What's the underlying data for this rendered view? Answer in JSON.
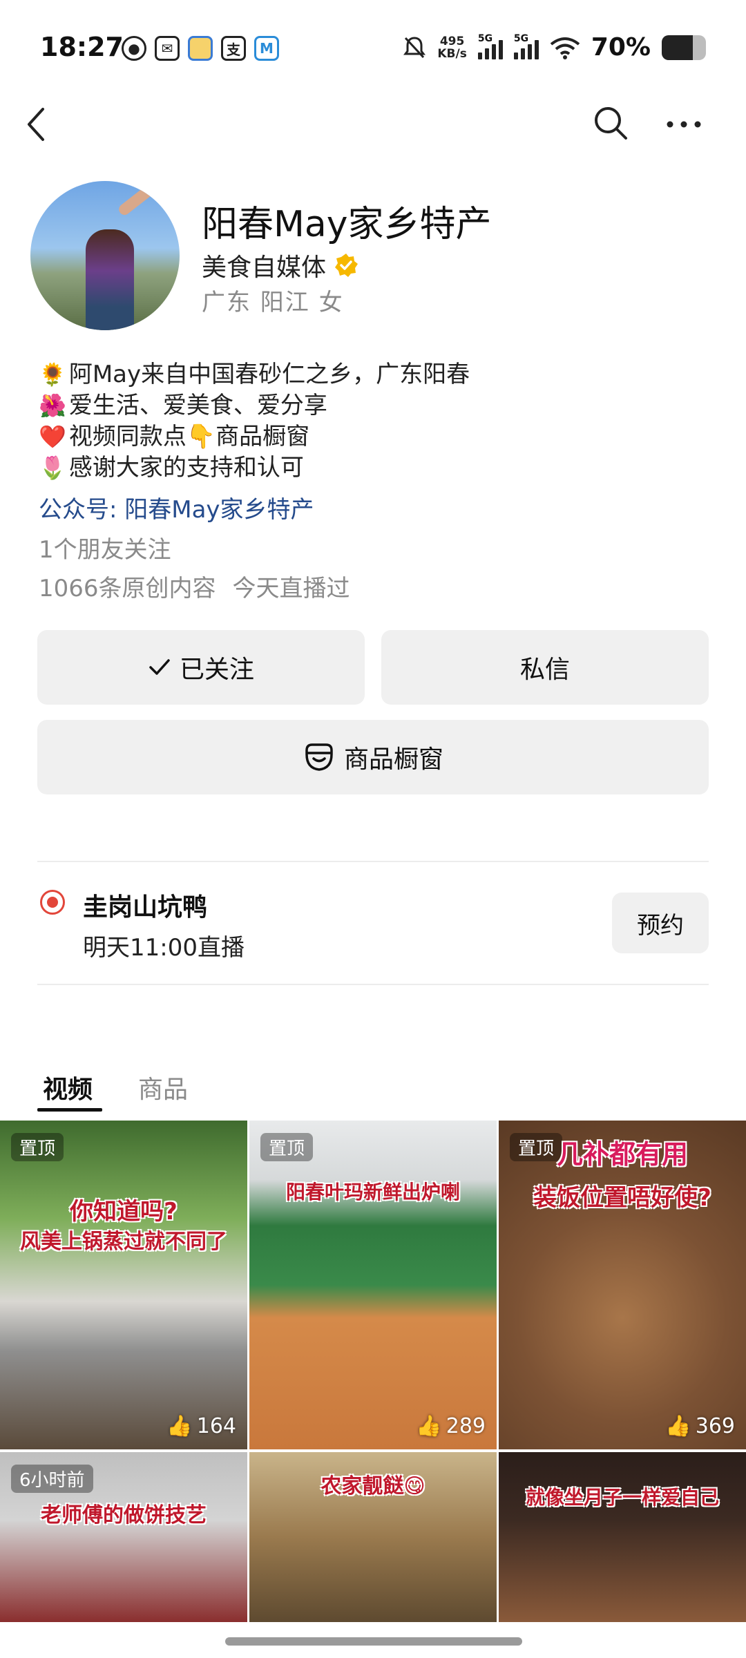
{
  "status_bar": {
    "time": "18:27",
    "net_speed_value": "495",
    "net_speed_unit": "KB/s",
    "sig1": "5G",
    "sig2": "5G",
    "battery": "70%",
    "battery_level": 0.7
  },
  "profile": {
    "name": "阳春May家乡特产",
    "category": "美食自媒体",
    "location": "广东 阳江 女",
    "bio": [
      {
        "emoji": "🌻",
        "text": "阿May来自中国春砂仁之乡，广东阳春"
      },
      {
        "emoji": "🌺",
        "text": "爱生活、爱美食、爱分享"
      },
      {
        "emoji": "❤️",
        "text": "视频同款点👇商品橱窗"
      },
      {
        "emoji": "🌷",
        "text": "感谢大家的支持和认可"
      }
    ],
    "official_account": "公众号: 阳春May家乡特产",
    "friends": "1个朋友关注",
    "original_count": "1066条原创内容",
    "live_status": "今天直播过"
  },
  "buttons": {
    "follow": "已关注",
    "message": "私信",
    "shop": "商品橱窗"
  },
  "live": {
    "title": "圭岗山坑鸭",
    "time": "明天11:00直播",
    "reserve": "预约"
  },
  "tabs": {
    "video": "视频",
    "goods": "商品"
  },
  "videos": [
    {
      "pin": "置顶",
      "cap1": "你知道吗?",
      "cap2": "风美上锅蒸过就不同了",
      "likes": "164"
    },
    {
      "pin": "置顶",
      "cap1": "阳春叶玛新鲜出炉喇",
      "likes": "289"
    },
    {
      "pin": "置顶",
      "cap1": "几补都有用",
      "cap2": "装饭位置唔好使?",
      "likes": "369"
    },
    {
      "pin": "6小时前",
      "cap1": "老师傅的做饼技艺"
    },
    {
      "cap1": "农家靓餸😋"
    },
    {
      "cap1": "就像坐月子一样爱自己"
    }
  ]
}
